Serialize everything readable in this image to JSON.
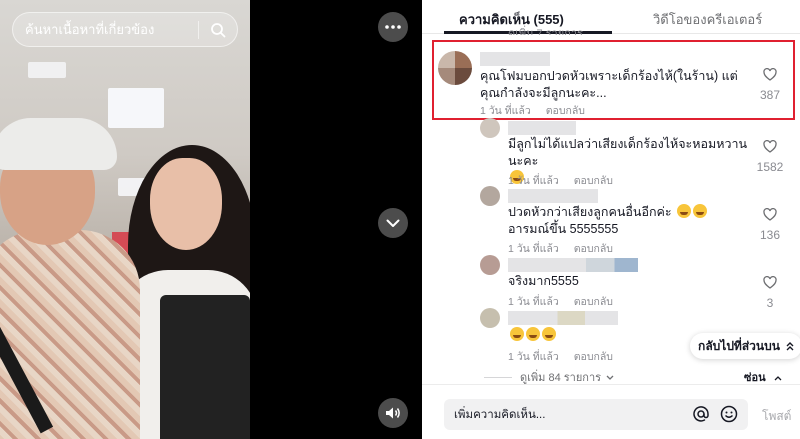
{
  "video": {
    "search_placeholder": "ค้นหาเนื้อหาที่เกี่ยวข้อง",
    "icons": [
      "search-icon",
      "more-icon",
      "chevron-down-icon",
      "volume-icon"
    ]
  },
  "tabs": {
    "comments": "ความคิดเห็น (555)",
    "creator_videos": "วิดีโอของครีเอเตอร์"
  },
  "truncated_header": "ดูเพิ่ม 7 รายการ",
  "comments": [
    {
      "text": "คุณโฟมบอกปวดหัวเพราะเด็กร้องไห้(ในร้าน) แต่คุณกำลังจะมีลูกนะคะ...",
      "time": "1 วัน ที่แล้ว",
      "reply": "ตอบกลับ",
      "likes": "387"
    },
    {
      "text": "มีลูกไม่ได้แปลว่าเสียงเด็กร้องไห้จะหอมหวานนะคะ",
      "time": "1 วัน ที่แล้ว",
      "reply": "ตอบกลับ",
      "likes": "1582"
    },
    {
      "text": "ปวดหัวกว่าเสียงลูกคนอื่นอีกค่ะ",
      "text_tail": "อารมณ์ขึ้น 5555555",
      "time": "1 วัน ที่แล้ว",
      "reply": "ตอบกลับ",
      "likes": "136"
    },
    {
      "text": "จริงมาก5555",
      "time": "1 วัน ที่แล้ว",
      "reply": "ตอบกลับ",
      "likes": "3"
    },
    {
      "text": "",
      "time": "1 วัน ที่แล้ว",
      "reply": "ตอบกลับ",
      "likes": ""
    }
  ],
  "more_replies": "ดูเพิ่ม 84 รายการ",
  "hide": "ซ่อน",
  "back_to_top": "กลับไปที่ส่วนบน",
  "composer": {
    "placeholder": "เพิ่มความคิดเห็น...",
    "post": "โพสต์"
  },
  "colors": {
    "highlight": "#e02030",
    "text": "#161823",
    "muted": "#8a8b91"
  }
}
